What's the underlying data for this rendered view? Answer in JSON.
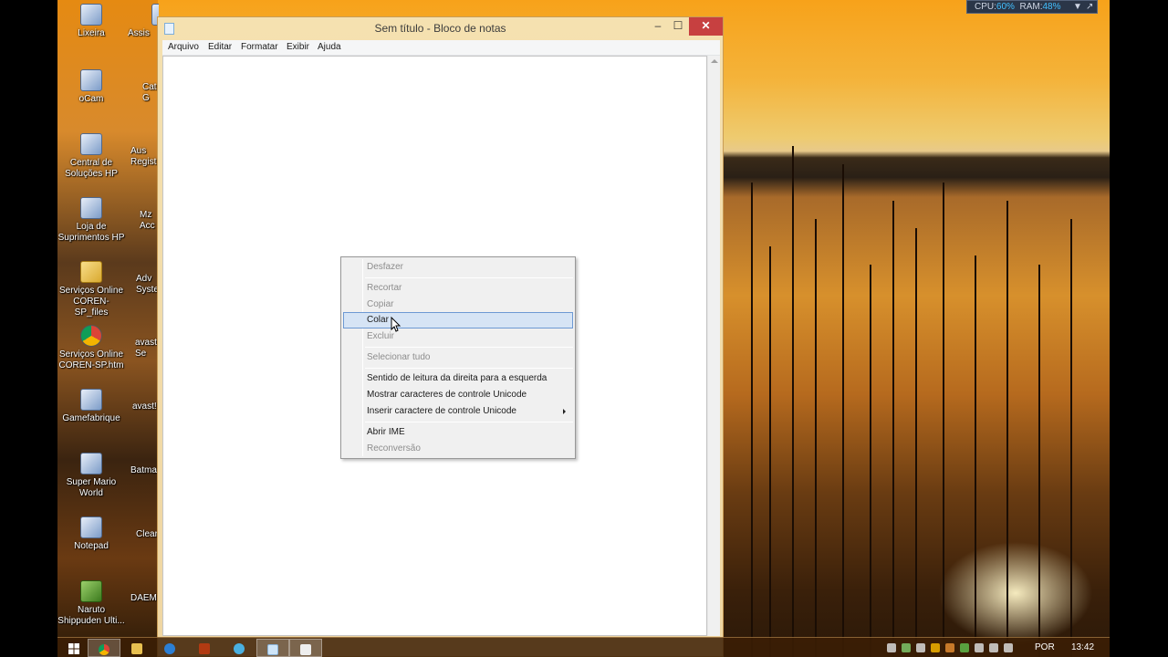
{
  "desktop": {
    "icons": [
      {
        "label": "Lixeira",
        "name": "recycle-bin-icon"
      },
      {
        "label": "oCam",
        "name": "ocam-icon"
      },
      {
        "label": "Central de Soluções HP",
        "name": "hp-solution-center-icon"
      },
      {
        "label": "Loja de Suprimentos HP",
        "name": "hp-supplies-store-icon"
      },
      {
        "label": "Serviços Online COREN-SP_files",
        "name": "folder-icon"
      },
      {
        "label": "Serviços Online COREN-SP.htm",
        "name": "chrome-icon"
      },
      {
        "label": "Gamefabrique",
        "name": "gamefabrique-icon"
      },
      {
        "label": "Super Mario World",
        "name": "super-mario-world-icon"
      },
      {
        "label": "Notepad",
        "name": "notepad-icon"
      },
      {
        "label": "Naruto Shippuden Ulti...",
        "name": "naruto-icon"
      }
    ],
    "partial_icons": [
      "Assis",
      "Cat G",
      "Aus Regist",
      "Mz Acc",
      "Adv Syste",
      "avast Se",
      "avast!",
      "Batma",
      "Clear",
      "DAEM"
    ]
  },
  "perf_meter": {
    "cpu_label": "CPU:",
    "cpu_value": "60%",
    "ram_label": "RAM:",
    "ram_value": "48%"
  },
  "window": {
    "title": "Sem título - Bloco de notas",
    "minimize": "–",
    "maximize": "☐",
    "close": "✕",
    "menu": [
      "Arquivo",
      "Editar",
      "Formatar",
      "Exibir",
      "Ajuda"
    ]
  },
  "context_menu": {
    "items": [
      {
        "label": "Desfazer",
        "disabled": true
      },
      {
        "label": "Recortar",
        "disabled": true
      },
      {
        "label": "Copiar",
        "disabled": true
      },
      {
        "label": "Colar",
        "disabled": false,
        "highlighted": true
      },
      {
        "label": "Excluir",
        "disabled": true
      },
      {
        "label": "Selecionar tudo",
        "disabled": true
      },
      {
        "label": "Sentido de leitura da direita para a esquerda",
        "disabled": false
      },
      {
        "label": "Mostrar caracteres de controle Unicode",
        "disabled": false
      },
      {
        "label": "Inserir caractere de controle Unicode",
        "disabled": false,
        "submenu": true
      },
      {
        "label": "Abrir IME",
        "disabled": false
      },
      {
        "label": "Reconversão",
        "disabled": true
      }
    ]
  },
  "taskbar": {
    "start_icon": "windows-start-icon",
    "pinned": [
      "chrome-icon",
      "file-explorer-icon",
      "ie-icon",
      "media-icon",
      "media-center-icon",
      "notepad-icon",
      "task-icon"
    ],
    "language": "POR",
    "clock": "13:42"
  },
  "colors": {
    "accent_blue": "#43c0ff",
    "hover_bg": "#d6e4f5",
    "hover_border": "#6d99d3",
    "close_btn": "#c74040"
  }
}
